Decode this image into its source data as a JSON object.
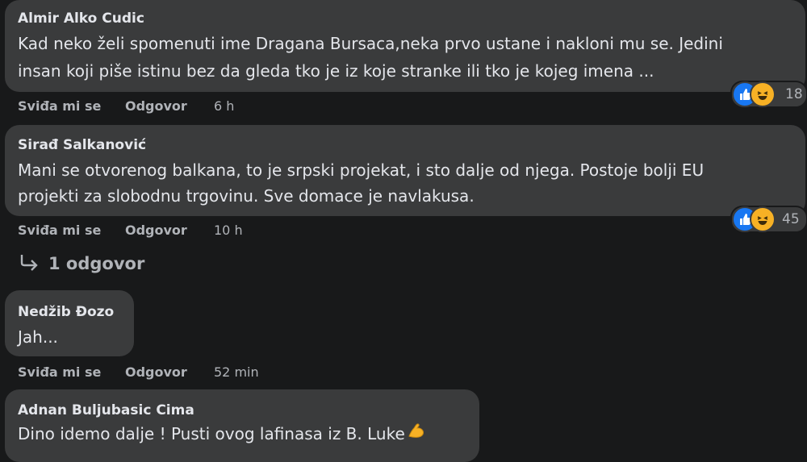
{
  "comments": [
    {
      "author": "Almir Alko Cudic",
      "lines": [
        "Kad neko želi spomenuti ime Dragana Bursaca,neka prvo ustane i nakloni mu se. Jedini",
        "insan koji piše istinu bez da gleda tko je iz koje stranke ili tko je kojeg imena ..."
      ],
      "like_label": "Sviđa mi se",
      "reply_label": "Odgovor",
      "time": "6 h",
      "reaction_count": "18"
    },
    {
      "author": "Sirađ Salkanović",
      "lines": [
        "Mani se otvorenog balkana, to je srpski projekat, i sto dalje od njega. Postoje bolji EU",
        "projekti za slobodnu trgovinu. Sve domace je navlakusa."
      ],
      "like_label": "Sviđa mi se",
      "reply_label": "Odgovor",
      "time": "10 h",
      "reaction_count": "45"
    },
    {
      "author": "Nedžib Đozo",
      "lines": [
        "Jah..."
      ],
      "like_label": "Sviđa mi se",
      "reply_label": "Odgovor",
      "time": "52 min"
    },
    {
      "author": "Adnan Buljubasic Cima",
      "lines": [
        "Dino idemo dalje ! Pusti ovog lafinasa iz B. Luke"
      ]
    }
  ],
  "replies_link": "1 odgovor",
  "icons": {
    "like": "like-icon",
    "haha": "haha-icon",
    "reply_arrow": "reply-arrow-icon",
    "flexed_biceps": "flexed-biceps-emoji"
  },
  "colors": {
    "background": "#18191a",
    "bubble": "#3a3b3c",
    "primary_text": "#e4e6eb",
    "secondary_text": "#b0b3b8",
    "like_blue": "#1877f2",
    "haha_yellow": "#f7b125"
  }
}
